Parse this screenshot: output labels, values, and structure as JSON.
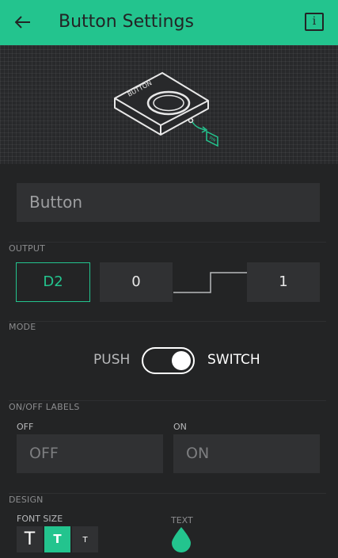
{
  "header": {
    "title": "Button Settings",
    "info_label": "i"
  },
  "hero": {
    "button_label": "BUTTON",
    "pin_label": "PIN"
  },
  "name_field": {
    "value": "Button"
  },
  "output": {
    "section_label": "OUTPUT",
    "pin": "D2",
    "low_value": "0",
    "high_value": "1"
  },
  "mode": {
    "section_label": "MODE",
    "push_label": "PUSH",
    "switch_label": "SWITCH",
    "selected": "SWITCH"
  },
  "labels": {
    "section_label": "ON/OFF LABELS",
    "off_caption": "OFF",
    "on_caption": "ON",
    "off_value": "OFF",
    "on_value": "ON"
  },
  "design": {
    "section_label": "DESIGN",
    "font_size_label": "FONT SIZE",
    "font_sizes": [
      "T",
      "T",
      "T"
    ],
    "font_size_selected_index": 1,
    "text_color_label": "TEXT",
    "text_color": "#23c48e"
  },
  "colors": {
    "accent": "#23c48e",
    "background": "#232425",
    "field": "#303133"
  }
}
